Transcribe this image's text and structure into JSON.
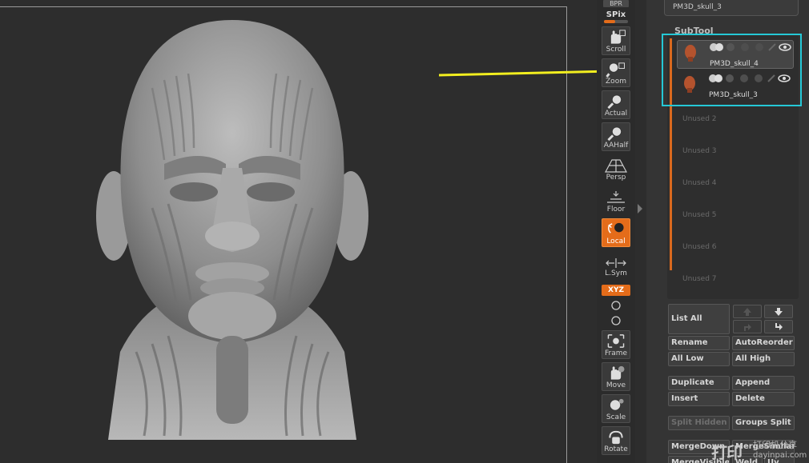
{
  "shelf": {
    "bpr": "BPR",
    "spix_label": "SPix",
    "spix_level": 0.45,
    "buttons": [
      {
        "label": "Scroll",
        "icon": "hand-scroll-icon"
      },
      {
        "label": "Zoom",
        "icon": "zoom-magnifier-icon"
      },
      {
        "label": "Actual",
        "icon": "actual-magnifier-icon"
      },
      {
        "label": "AAHalf",
        "icon": "aahalf-magnifier-icon"
      },
      {
        "label": "Persp",
        "icon": "perspective-grid-icon"
      },
      {
        "label": "Floor",
        "icon": "floor-grid-icon"
      },
      {
        "label": "Local",
        "icon": "local-pivot-icon",
        "active": true
      },
      {
        "label": "L.Sym",
        "icon": "local-symmetry-icon"
      },
      {
        "label": "Frame",
        "icon": "frame-icon"
      },
      {
        "label": "Move",
        "icon": "hand-move-icon"
      },
      {
        "label": "Scale",
        "icon": "scale-icon"
      },
      {
        "label": "Rotate",
        "icon": "rotate-icon"
      }
    ],
    "xyz_label": "XYZ"
  },
  "panel": {
    "top_item": "PM3D_skull_3",
    "subtool_title": "SubTool",
    "items": [
      {
        "name": "PM3D_skull_4",
        "selected": true
      },
      {
        "name": "PM3D_skull_3",
        "selected": false
      }
    ],
    "unused": [
      "Unused 2",
      "Unused 3",
      "Unused 4",
      "Unused 5",
      "Unused 6",
      "Unused 7"
    ],
    "buttons": {
      "list_all": "List All",
      "rename": "Rename",
      "auto_reorder": "AutoReorder",
      "all_low": "All Low",
      "all_high": "All High",
      "duplicate": "Duplicate",
      "append": "Append",
      "insert": "Insert",
      "delete": "Delete",
      "split_hidden": "Split Hidden",
      "groups_split": "Groups Split",
      "merge_down": "MergeDown",
      "merge_similar": "MergeSimilar",
      "merge_visible": "MergeVisible",
      "weld": "Weld",
      "uv": "Uv"
    }
  },
  "colors": {
    "accent": "#e46c1a",
    "highlight": "#25c8d6",
    "callout": "#f2ee1f"
  },
  "watermark": {
    "logo": "打印",
    "cn": "打印机分享",
    "url": "dayinpai.com"
  }
}
